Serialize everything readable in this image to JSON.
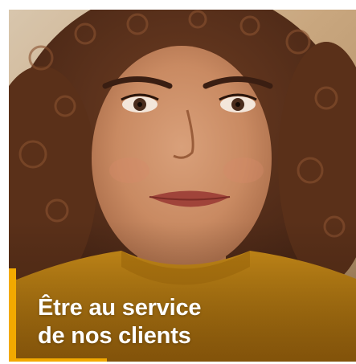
{
  "hero": {
    "headline_line1": "Être au service",
    "headline_line2": "de nos clients"
  },
  "colors": {
    "accent": "#f2a900",
    "headline_text": "#ffffff",
    "background": "#ffffff"
  },
  "image": {
    "subject": "smiling woman with curly hair in mustard sweater"
  }
}
